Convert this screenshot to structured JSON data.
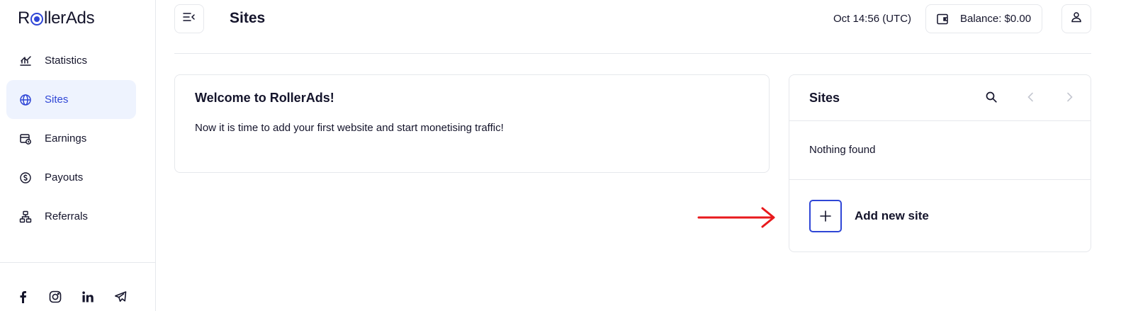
{
  "brand": {
    "logo_text_before": "R",
    "logo_text_after": "llerAds",
    "accent_color": "#2f46d6"
  },
  "sidebar": {
    "items": [
      {
        "label": "Statistics",
        "icon": "statistics-icon",
        "active": false
      },
      {
        "label": "Sites",
        "icon": "globe-icon",
        "active": true
      },
      {
        "label": "Earnings",
        "icon": "earnings-icon",
        "active": false
      },
      {
        "label": "Payouts",
        "icon": "dollar-coin-icon",
        "active": false
      },
      {
        "label": "Referrals",
        "icon": "network-icon",
        "active": false
      }
    ],
    "socials": [
      "facebook-icon",
      "instagram-icon",
      "linkedin-icon",
      "telegram-icon"
    ]
  },
  "header": {
    "title": "Sites",
    "datetime": "Oct 14:56 (UTC)",
    "balance": "Balance: $0.00"
  },
  "welcome": {
    "title": "Welcome to RollerAds!",
    "text": "Now it is time to add your first website and start monetising traffic!"
  },
  "sites_panel": {
    "title": "Sites",
    "empty_text": "Nothing found",
    "add_label": "Add new site"
  },
  "annotation": {
    "arrow_color": "#e8191c"
  }
}
